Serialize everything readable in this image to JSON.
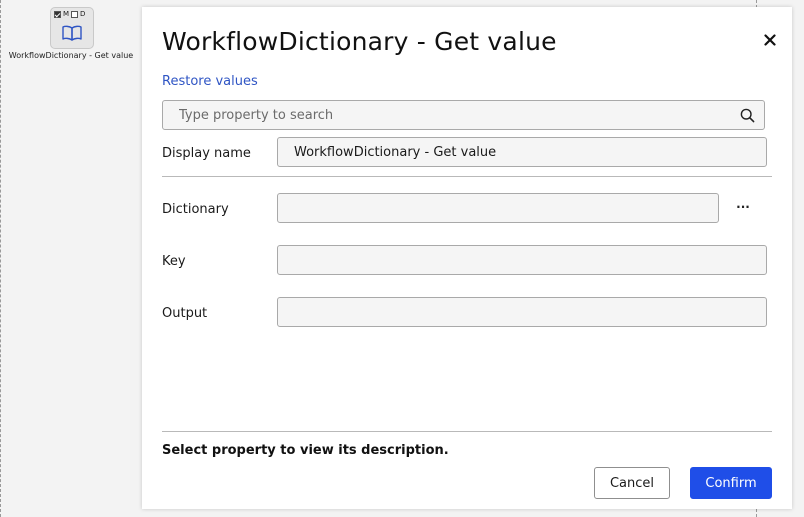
{
  "canvas": {
    "node": {
      "flag_m": "M",
      "flag_d": "D",
      "flag_m_checked": true,
      "flag_d_checked": false,
      "icon": "book-icon",
      "caption": "WorkflowDictionary - Get value"
    }
  },
  "dialog": {
    "title": "WorkflowDictionary - Get value",
    "close_icon": "close-icon",
    "restore_label": "Restore values",
    "search": {
      "placeholder": "Type property to search",
      "value": "",
      "icon": "search-icon"
    },
    "display_name": {
      "label": "Display name",
      "value": "WorkflowDictionary - Get value"
    },
    "properties": [
      {
        "label": "Dictionary",
        "value": "",
        "has_browse": true,
        "browse_label": "···"
      },
      {
        "label": "Key",
        "value": ""
      },
      {
        "label": "Output",
        "value": ""
      }
    ],
    "description": "Select property to view its description.",
    "cancel_label": "Cancel",
    "confirm_label": "Confirm"
  },
  "colors": {
    "accent": "#1f4ee8",
    "link": "#2f55c4",
    "field_bg": "#f5f5f5"
  }
}
